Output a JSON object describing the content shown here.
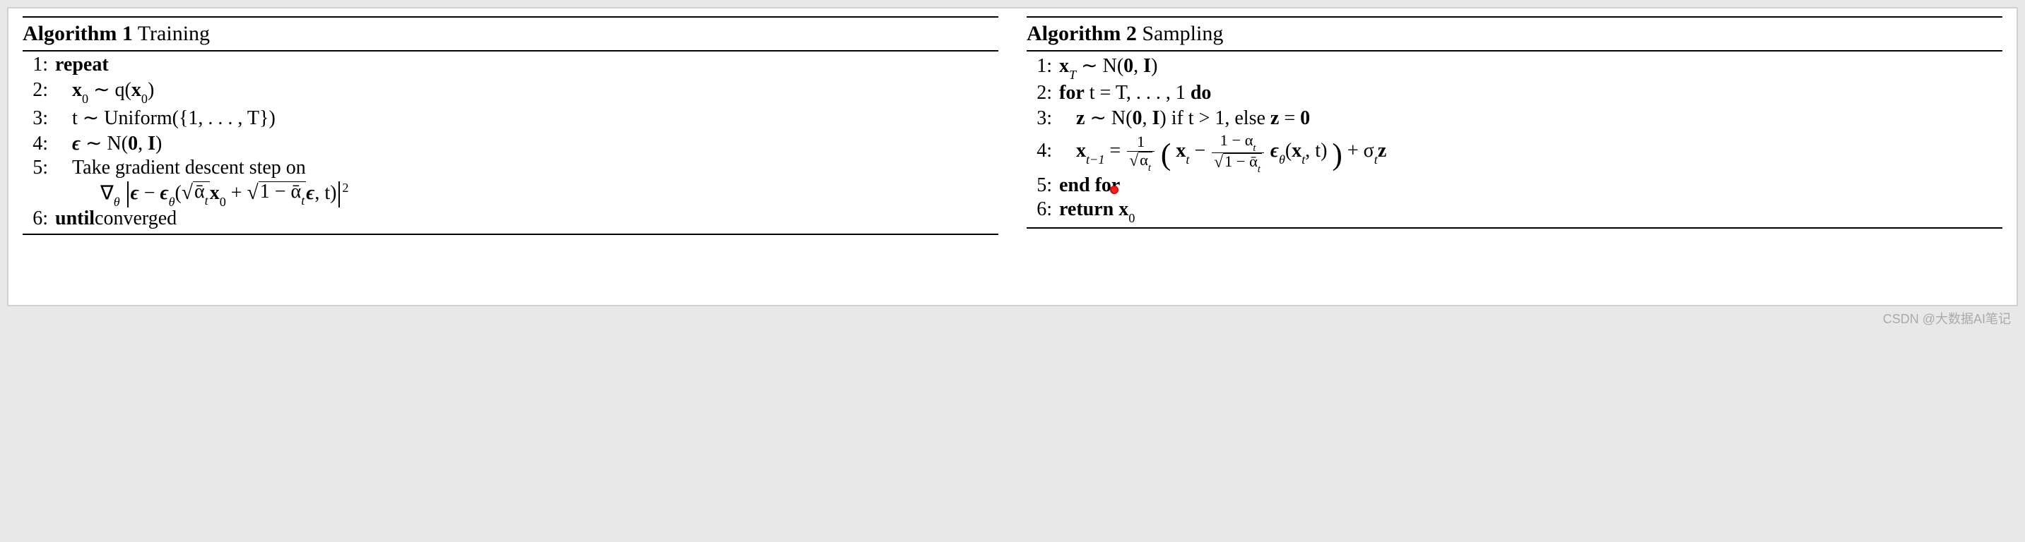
{
  "left": {
    "head_bold": "Algorithm 1",
    "head_rest": " Training",
    "l1": "repeat",
    "l2_a": "x",
    "l2_b": " ∼ q(",
    "l2_c": "x",
    "l2_d": ")",
    "l3": "t ∼ Uniform({1, . . . , T})",
    "l4_a": "ϵ",
    "l4_b": " ∼ ",
    "l4_c": "N",
    "l4_d": "(",
    "l4_e": "0",
    "l4_f": ", ",
    "l4_g": "I",
    "l4_h": ")",
    "l5": "Take gradient descent step on",
    "eq_grad": "∇",
    "eq_th": "θ",
    "eq_eps1": "ϵ",
    "eq_minus": " − ",
    "eq_eps2": "ϵ",
    "eq_th2": "θ",
    "eq_op": "(",
    "eq_r1": "ᾱ",
    "eq_r1s": "t",
    "eq_x0": "x",
    "eq_zero": "0",
    "eq_plus": " + ",
    "eq_r2a": "1 − ᾱ",
    "eq_r2s": "t",
    "eq_eps3": "ϵ",
    "eq_ct": ", t)",
    "eq_sq": "2",
    "l6a": "until",
    "l6b": " converged"
  },
  "right": {
    "head_bold": "Algorithm 2",
    "head_rest": " Sampling",
    "l1_a": "x",
    "l1_T": "T",
    "l1_b": " ∼ ",
    "l1_c": "N",
    "l1_d": "(",
    "l1_e": "0",
    "l1_f": ", ",
    "l1_g": "I",
    "l1_h": ")",
    "l2a": "for",
    "l2b": " t = T, . . . , 1 ",
    "l2c": "do",
    "l3_a": "z",
    "l3_b": " ∼ ",
    "l3_c": "N",
    "l3_d": "(",
    "l3_e": "0",
    "l3_f": ", ",
    "l3_g": "I",
    "l3_h": ")",
    "l3_i": " if t > 1, else ",
    "l3_j": "z",
    "l3_k": " = ",
    "l3_l": "0",
    "l4_x": "x",
    "l4_tm1": "t−1",
    "l4_eq": " = ",
    "l4_f1n": "1",
    "l4_f1d_a": "α",
    "l4_f1d_s": "t",
    "l4_op": "(",
    "l4_cp": ")",
    "l4_xt": "x",
    "l4_ts": "t",
    "l4_minus": " − ",
    "l4_f2n_a": "1 − α",
    "l4_f2n_s": "t",
    "l4_f2d_a": "1 − ᾱ",
    "l4_f2d_s": "t",
    "l4_eps": "ϵ",
    "l4_th": "θ",
    "l4_op2": "(",
    "l4_xt2": "x",
    "l4_ts2": "t",
    "l4_ct": ", t)",
    "l4_plus": " + σ",
    "l4_sig_s": "t",
    "l4_z": "z",
    "l5": "end for",
    "l6a": "return",
    "l6b": " x",
    "l6c": "0"
  },
  "watermark": "CSDN @大数据AI笔记"
}
